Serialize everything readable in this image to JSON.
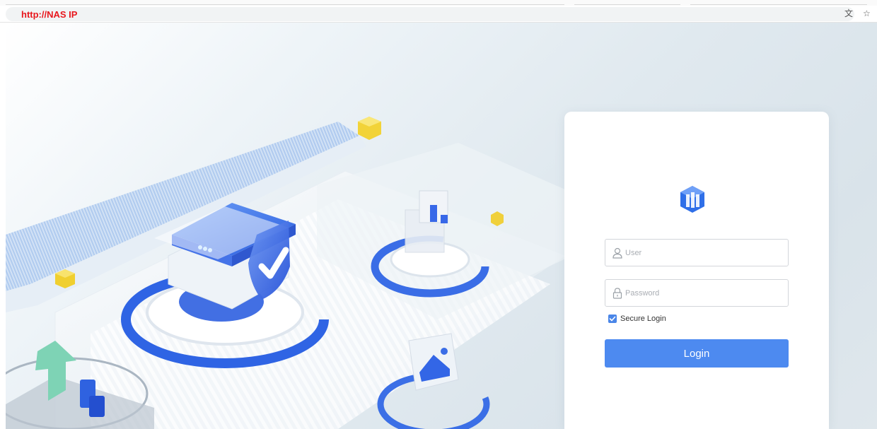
{
  "browser": {
    "url": "http://NAS IP",
    "translate_icon": "translate-icon",
    "bookmark_icon": "star-icon"
  },
  "login": {
    "logo_icon": "nas-logo-icon",
    "user_placeholder": "User",
    "password_placeholder": "Password",
    "secure_login_label": "Secure Login",
    "secure_login_checked": true,
    "login_button": "Login"
  },
  "colors": {
    "accent": "#4d8af0",
    "url_text": "#e8171d",
    "logo_blue": "#2f6fe8"
  }
}
